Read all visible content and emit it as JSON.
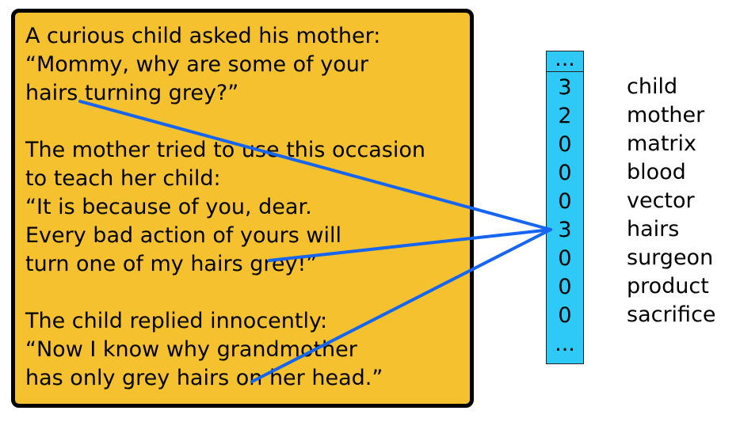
{
  "story": {
    "lines": [
      "A curious child asked his mother:",
      "“Mommy, why are some of your",
      "hairs turning grey?”",
      "",
      "The mother tried to use this occasion",
      "to teach her child:",
      "“It is because of you, dear.",
      "Every bad action of yours will",
      "turn one of my hairs grey!”",
      "",
      "The child replied innocently:",
      "“Now I know why grandmother",
      "has only grey hairs on her head.”"
    ]
  },
  "vector": {
    "top_ellipsis": "...",
    "bottom_ellipsis": "...",
    "values": [
      "3",
      "2",
      "0",
      "0",
      "0",
      "3",
      "0",
      "0",
      "0"
    ],
    "words": [
      "child",
      "mother",
      "matrix",
      "blood",
      "vector",
      "hairs",
      "surgeon",
      "product",
      "sacrifice"
    ]
  },
  "colors": {
    "story_background": "#f6c12f",
    "vector_background": "#2ec9f7",
    "connector": "#1565f0"
  }
}
